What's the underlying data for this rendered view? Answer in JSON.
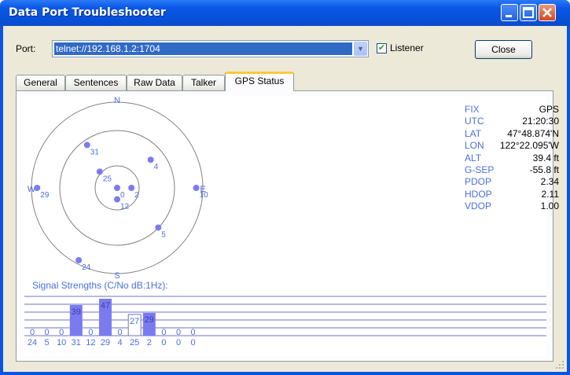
{
  "window": {
    "title": "Data Port Troubleshooter"
  },
  "port": {
    "label": "Port:",
    "value": "telnet://192.168.1.2:1704"
  },
  "listener": {
    "label": "Listener",
    "checked": true
  },
  "close_label": "Close",
  "tabs": [
    {
      "label": "General",
      "active": false
    },
    {
      "label": "Sentences",
      "active": false
    },
    {
      "label": "Raw Data",
      "active": false
    },
    {
      "label": "Talker",
      "active": false
    },
    {
      "label": "GPS Status",
      "active": true
    }
  ],
  "sky": {
    "directions": {
      "n": "N",
      "s": "S",
      "e": "E",
      "w": "W"
    },
    "satellites": [
      {
        "prn": "0",
        "azimuth": 0,
        "elevation": 90
      },
      {
        "prn": "31",
        "azimuth": 325,
        "elevation": 35
      },
      {
        "prn": "4",
        "azimuth": 50,
        "elevation": 44
      },
      {
        "prn": "25",
        "azimuth": 313,
        "elevation": 65
      },
      {
        "prn": "29",
        "azimuth": 270,
        "elevation": 6
      },
      {
        "prn": "10",
        "azimuth": 90,
        "elevation": 7
      },
      {
        "prn": "2",
        "azimuth": 90,
        "elevation": 75
      },
      {
        "prn": "12",
        "azimuth": 180,
        "elevation": 78
      },
      {
        "prn": "24",
        "azimuth": 208,
        "elevation": 4
      },
      {
        "prn": "5",
        "azimuth": 134,
        "elevation": 30
      }
    ]
  },
  "fix_info": [
    {
      "key": "FIX",
      "value": "GPS"
    },
    {
      "key": "UTC",
      "value": "21:20:30"
    },
    {
      "key": "LAT",
      "value": "47°48.874'N"
    },
    {
      "key": "LON",
      "value": "122°22.095'W"
    },
    {
      "key": "ALT",
      "value": "39.4 ft"
    },
    {
      "key": "G-SEP",
      "value": "-55.8 ft"
    },
    {
      "key": "PDOP",
      "value": "2.34"
    },
    {
      "key": "HDOP",
      "value": "2.11"
    },
    {
      "key": "VDOP",
      "value": "1.00"
    }
  ],
  "signal_title": "Signal Strengths (C/No dB:1Hz):",
  "chart_data": {
    "type": "bar",
    "title": "Signal Strengths (C/No dB:1Hz):",
    "categories": [
      "24",
      "5",
      "10",
      "31",
      "12",
      "29",
      "4",
      "25",
      "2",
      "0",
      "0",
      "0"
    ],
    "values": [
      0,
      0,
      0,
      39,
      0,
      47,
      0,
      27,
      29,
      0,
      0,
      0
    ],
    "used_in_fix": [
      false,
      false,
      false,
      true,
      false,
      true,
      false,
      false,
      true,
      false,
      false,
      false
    ],
    "ylim": [
      0,
      55
    ],
    "gridlines": [
      10,
      20,
      30,
      40,
      50
    ]
  },
  "colors": {
    "accent": "#4A6FE0",
    "bar": "#7B7BF0",
    "sat": "#7B7BF0",
    "title_bar": "#0A58E6"
  }
}
